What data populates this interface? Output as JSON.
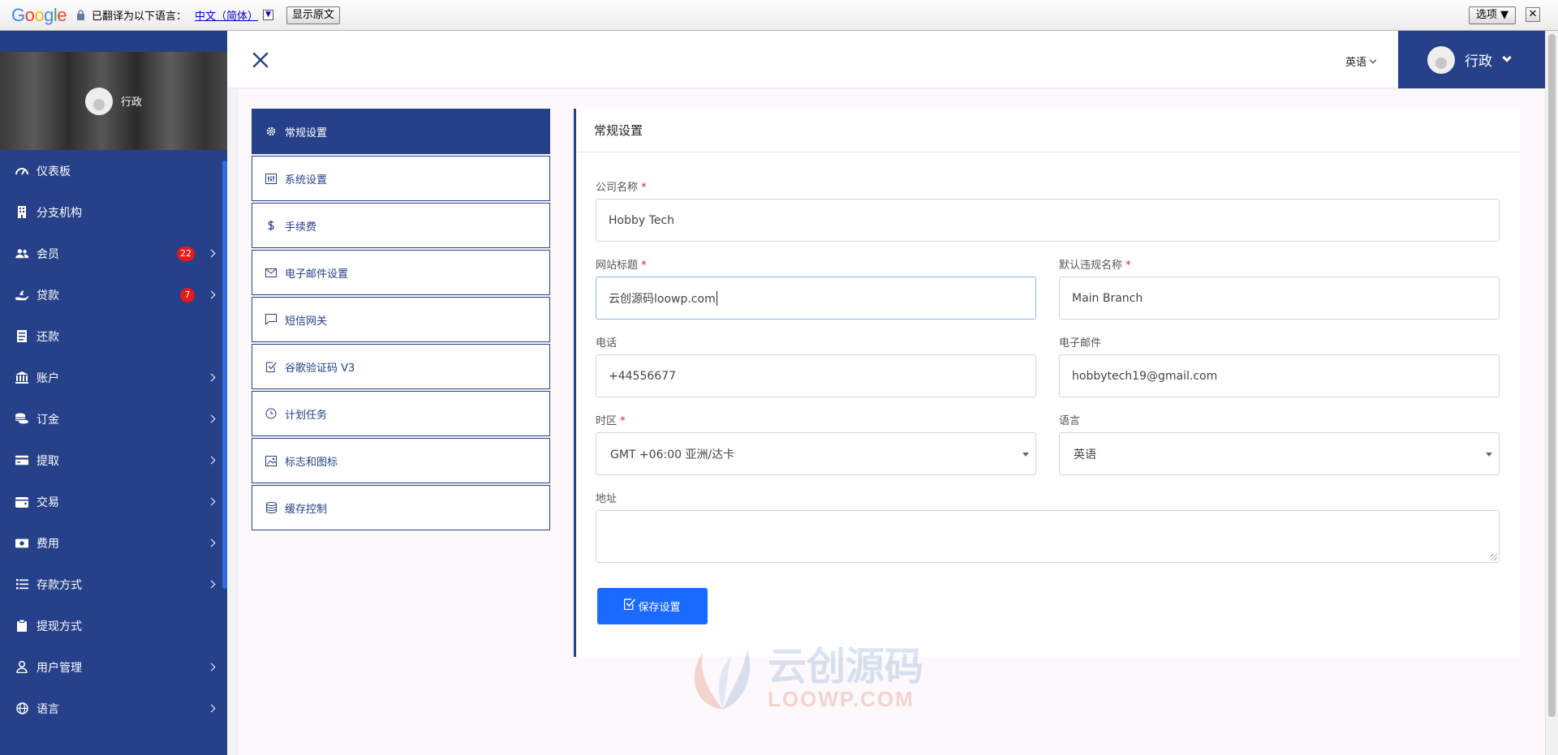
{
  "translate_bar": {
    "logo": "Google",
    "translated_to_label": "已翻译为以下语言：",
    "language": "中文（简体）",
    "dropdown_glyph": "▼",
    "show_original_button": "显示原文",
    "options_button": "选项 ▼",
    "close_button": "✕"
  },
  "sidebar": {
    "profile_name": "行政",
    "items": [
      {
        "label": "仪表板",
        "icon": "dashboard-icon",
        "badge": null,
        "has_submenu": false
      },
      {
        "label": "分支机构",
        "icon": "building-icon",
        "badge": null,
        "has_submenu": false
      },
      {
        "label": "会员",
        "icon": "users-icon",
        "badge": "22",
        "has_submenu": true
      },
      {
        "label": "贷款",
        "icon": "hand-holding-icon",
        "badge": "7",
        "has_submenu": true
      },
      {
        "label": "还款",
        "icon": "receipt-icon",
        "badge": null,
        "has_submenu": false
      },
      {
        "label": "账户",
        "icon": "bank-icon",
        "badge": null,
        "has_submenu": true
      },
      {
        "label": "订金",
        "icon": "coins-icon",
        "badge": null,
        "has_submenu": true
      },
      {
        "label": "提取",
        "icon": "credit-card-icon",
        "badge": null,
        "has_submenu": true
      },
      {
        "label": "交易",
        "icon": "wallet-icon",
        "badge": null,
        "has_submenu": true
      },
      {
        "label": "费用",
        "icon": "money-bill-icon",
        "badge": null,
        "has_submenu": true
      },
      {
        "label": "存款方式",
        "icon": "list-icon",
        "badge": null,
        "has_submenu": true
      },
      {
        "label": "提现方式",
        "icon": "clipboard-icon",
        "badge": null,
        "has_submenu": false
      },
      {
        "label": "用户管理",
        "icon": "user-icon",
        "badge": null,
        "has_submenu": true
      },
      {
        "label": "语言",
        "icon": "globe-icon",
        "badge": null,
        "has_submenu": true
      }
    ]
  },
  "header": {
    "language_selector": "英语",
    "user_name": "行政"
  },
  "settings_nav": {
    "items": [
      {
        "label": "常规设置",
        "icon": "gear-icon",
        "active": true
      },
      {
        "label": "系统设置",
        "icon": "sliders-icon",
        "active": false
      },
      {
        "label": "手续费",
        "icon": "dollar-icon",
        "active": false
      },
      {
        "label": "电子邮件设置",
        "icon": "envelope-icon",
        "active": false
      },
      {
        "label": "短信网关",
        "icon": "message-icon",
        "active": false
      },
      {
        "label": "谷歌验证码 V3",
        "icon": "check-square-icon",
        "active": false
      },
      {
        "label": "计划任务",
        "icon": "clock-icon",
        "active": false
      },
      {
        "label": "标志和图标",
        "icon": "image-icon",
        "active": false
      },
      {
        "label": "缓存控制",
        "icon": "database-icon",
        "active": false
      }
    ]
  },
  "form": {
    "title": "常规设置",
    "required_mark": "*",
    "company_name": {
      "label": "公司名称",
      "value": "Hobby Tech"
    },
    "site_title": {
      "label": "网站标题",
      "value": "云创源码loowp.com"
    },
    "default_branch": {
      "label": "默认违规名称",
      "value": "Main Branch"
    },
    "phone": {
      "label": "电话",
      "value": "+44556677"
    },
    "email": {
      "label": "电子邮件",
      "value": "hobbytech19@gmail.com"
    },
    "timezone": {
      "label": "时区",
      "value": "GMT +06:00 亚洲/达卡"
    },
    "language": {
      "label": "语言",
      "value": "英语"
    },
    "address": {
      "label": "地址",
      "value": ""
    },
    "save_button": "保存设置"
  },
  "watermark": {
    "cn": "云创源码",
    "en": "LOOWP.COM"
  },
  "colors": {
    "sidebar_bg": "#26418a",
    "primary_button": "#1b6aff",
    "badge": "#e21b1b",
    "required": "#e02222"
  }
}
